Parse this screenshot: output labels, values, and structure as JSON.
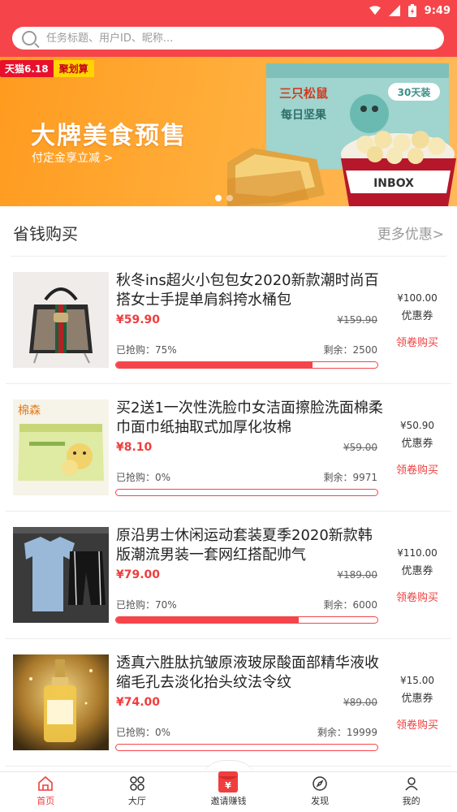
{
  "status_bar": {
    "time": "9:49"
  },
  "search": {
    "placeholder": "任务标题、用户ID、昵称..."
  },
  "banner": {
    "tag_tmall": "天猫6.18",
    "tag_juhuasuan": "聚划算",
    "headline": "大牌美食预售",
    "subline": "付定金享立减 >",
    "product_box_text": "三只松鼠",
    "product_box_sub": "每日坚果",
    "badge": "30天装",
    "bucket_brand": "INBOX",
    "slide_count": 2,
    "active_slide": 1
  },
  "section": {
    "title": "省钱购买",
    "more": "更多优惠>"
  },
  "products": [
    {
      "name": "秋冬ins超火小包包女2020新款潮时尚百搭女士手提单肩斜挎水桶包",
      "price": "¥59.90",
      "original_price": "¥159.90",
      "sold": "已抢购：75%",
      "remaining": "剩余：2500",
      "progress": 0.75,
      "coupon_value": "¥100.00",
      "coupon_label": "优惠券",
      "action": "领卷购买",
      "image_icon": "handbag-image"
    },
    {
      "name": "买2送1一次性洗脸巾女洁面擦脸洗面棉柔巾面巾纸抽取式加厚化妆棉",
      "price": "¥8.10",
      "original_price": "¥59.00",
      "sold": "已抢购：0%",
      "remaining": "剩余：9971",
      "progress": 0,
      "coupon_value": "¥50.90",
      "coupon_label": "优惠券",
      "action": "领卷购买",
      "image_icon": "face-towel-image",
      "image_brand": "棉森"
    },
    {
      "name": "原沿男士休闲运动套装夏季2020新款韩版潮流男装一套网红搭配帅气",
      "price": "¥79.00",
      "original_price": "¥189.00",
      "sold": "已抢购：70%",
      "remaining": "剩余：6000",
      "progress": 0.7,
      "coupon_value": "¥110.00",
      "coupon_label": "优惠券",
      "action": "领卷购买",
      "image_icon": "sportswear-image"
    },
    {
      "name": "透真六胜肽抗皱原液玻尿酸面部精华液收缩毛孔去淡化抬头纹法令纹",
      "price": "¥74.00",
      "original_price": "¥89.00",
      "sold": "已抢购：0%",
      "remaining": "剩余：19999",
      "progress": 0,
      "coupon_value": "¥15.00",
      "coupon_label": "优惠券",
      "action": "领卷购买",
      "image_icon": "serum-bottle-image"
    }
  ],
  "tabbar": {
    "home": "首页",
    "hall": "大厅",
    "invite": "邀请赚钱",
    "discover": "发现",
    "mine": "我的",
    "invite_symbol": "¥"
  },
  "colors": {
    "brand_red": "#f5454a",
    "price_red": "#f03d3d",
    "banner_orange": "#ffa52f"
  }
}
